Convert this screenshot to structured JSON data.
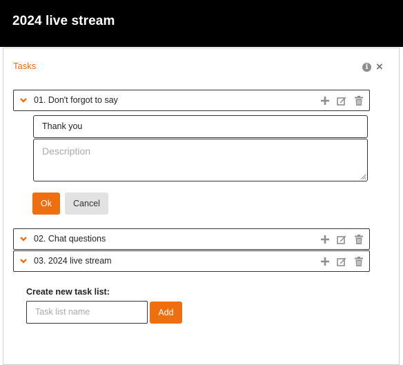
{
  "header": {
    "title": "2024 live stream"
  },
  "panel": {
    "title": "Tasks",
    "info_icon": "info-icon",
    "close_glyph": "×"
  },
  "tasks": [
    {
      "label": "01. Don't forgot to say",
      "expanded": true
    },
    {
      "label": "02. Chat questions",
      "expanded": false
    },
    {
      "label": "03. 2024 live stream",
      "expanded": false
    }
  ],
  "editor": {
    "title_value": "Thank you",
    "description_placeholder": "Description",
    "ok_label": "Ok",
    "cancel_label": "Cancel"
  },
  "create": {
    "label": "Create new task list:",
    "placeholder": "Task list name",
    "add_label": "Add"
  },
  "colors": {
    "accent": "#ef6e0f",
    "header_bg": "#000000",
    "icon_gray": "#8d8d8d"
  }
}
